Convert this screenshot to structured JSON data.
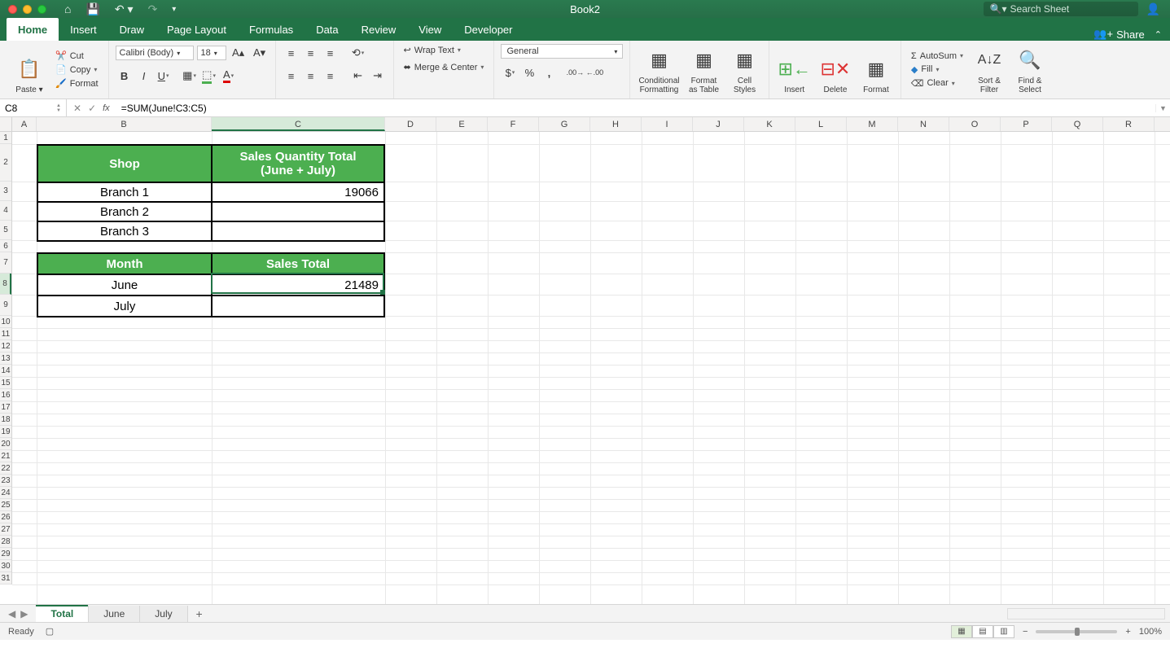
{
  "title": "Book2",
  "search_placeholder": "Search Sheet",
  "tabs": [
    "Home",
    "Insert",
    "Draw",
    "Page Layout",
    "Formulas",
    "Data",
    "Review",
    "View",
    "Developer"
  ],
  "active_tab": "Home",
  "share_label": "Share",
  "clipboard": {
    "paste": "Paste",
    "cut": "Cut",
    "copy": "Copy",
    "format": "Format"
  },
  "font": {
    "name": "Calibri (Body)",
    "size": "18"
  },
  "alignment": {
    "wrap": "Wrap Text",
    "merge": "Merge & Center"
  },
  "number": {
    "format": "General"
  },
  "styles": {
    "cond": "Conditional\nFormatting",
    "fat": "Format\nas Table",
    "cell": "Cell\nStyles"
  },
  "cells_group": {
    "insert": "Insert",
    "delete": "Delete",
    "format": "Format"
  },
  "editing": {
    "autosum": "AutoSum",
    "fill": "Fill",
    "clear": "Clear",
    "sort": "Sort &\nFilter",
    "find": "Find &\nSelect"
  },
  "namebox": "C8",
  "formula": "=SUM(June!C3:C5)",
  "columns": [
    "A",
    "B",
    "C",
    "D",
    "E",
    "F",
    "G",
    "H",
    "I",
    "J",
    "K",
    "L",
    "M",
    "N",
    "O",
    "P",
    "Q",
    "R"
  ],
  "col_widths": {
    "A": 30,
    "B": 215,
    "C": 213,
    "default": 63
  },
  "row_count": 31,
  "row_heights": {
    "1": 15,
    "2": 46,
    "3": 24,
    "4": 24,
    "5": 24,
    "6": 15,
    "7": 26,
    "8": 26,
    "9": 26
  },
  "selected_col": "C",
  "selected_row": 8,
  "table1": {
    "headers": [
      "Shop",
      "Sales Quantity Total\n(June + July)"
    ],
    "rows": [
      [
        "Branch 1",
        "19066"
      ],
      [
        "Branch 2",
        ""
      ],
      [
        "Branch 3",
        ""
      ]
    ]
  },
  "table2": {
    "headers": [
      "Month",
      "Sales Total"
    ],
    "rows": [
      [
        "June",
        "21489"
      ],
      [
        "July",
        ""
      ]
    ]
  },
  "sheets": [
    "Total",
    "June",
    "July"
  ],
  "active_sheet": "Total",
  "status": "Ready",
  "zoom": "100%"
}
